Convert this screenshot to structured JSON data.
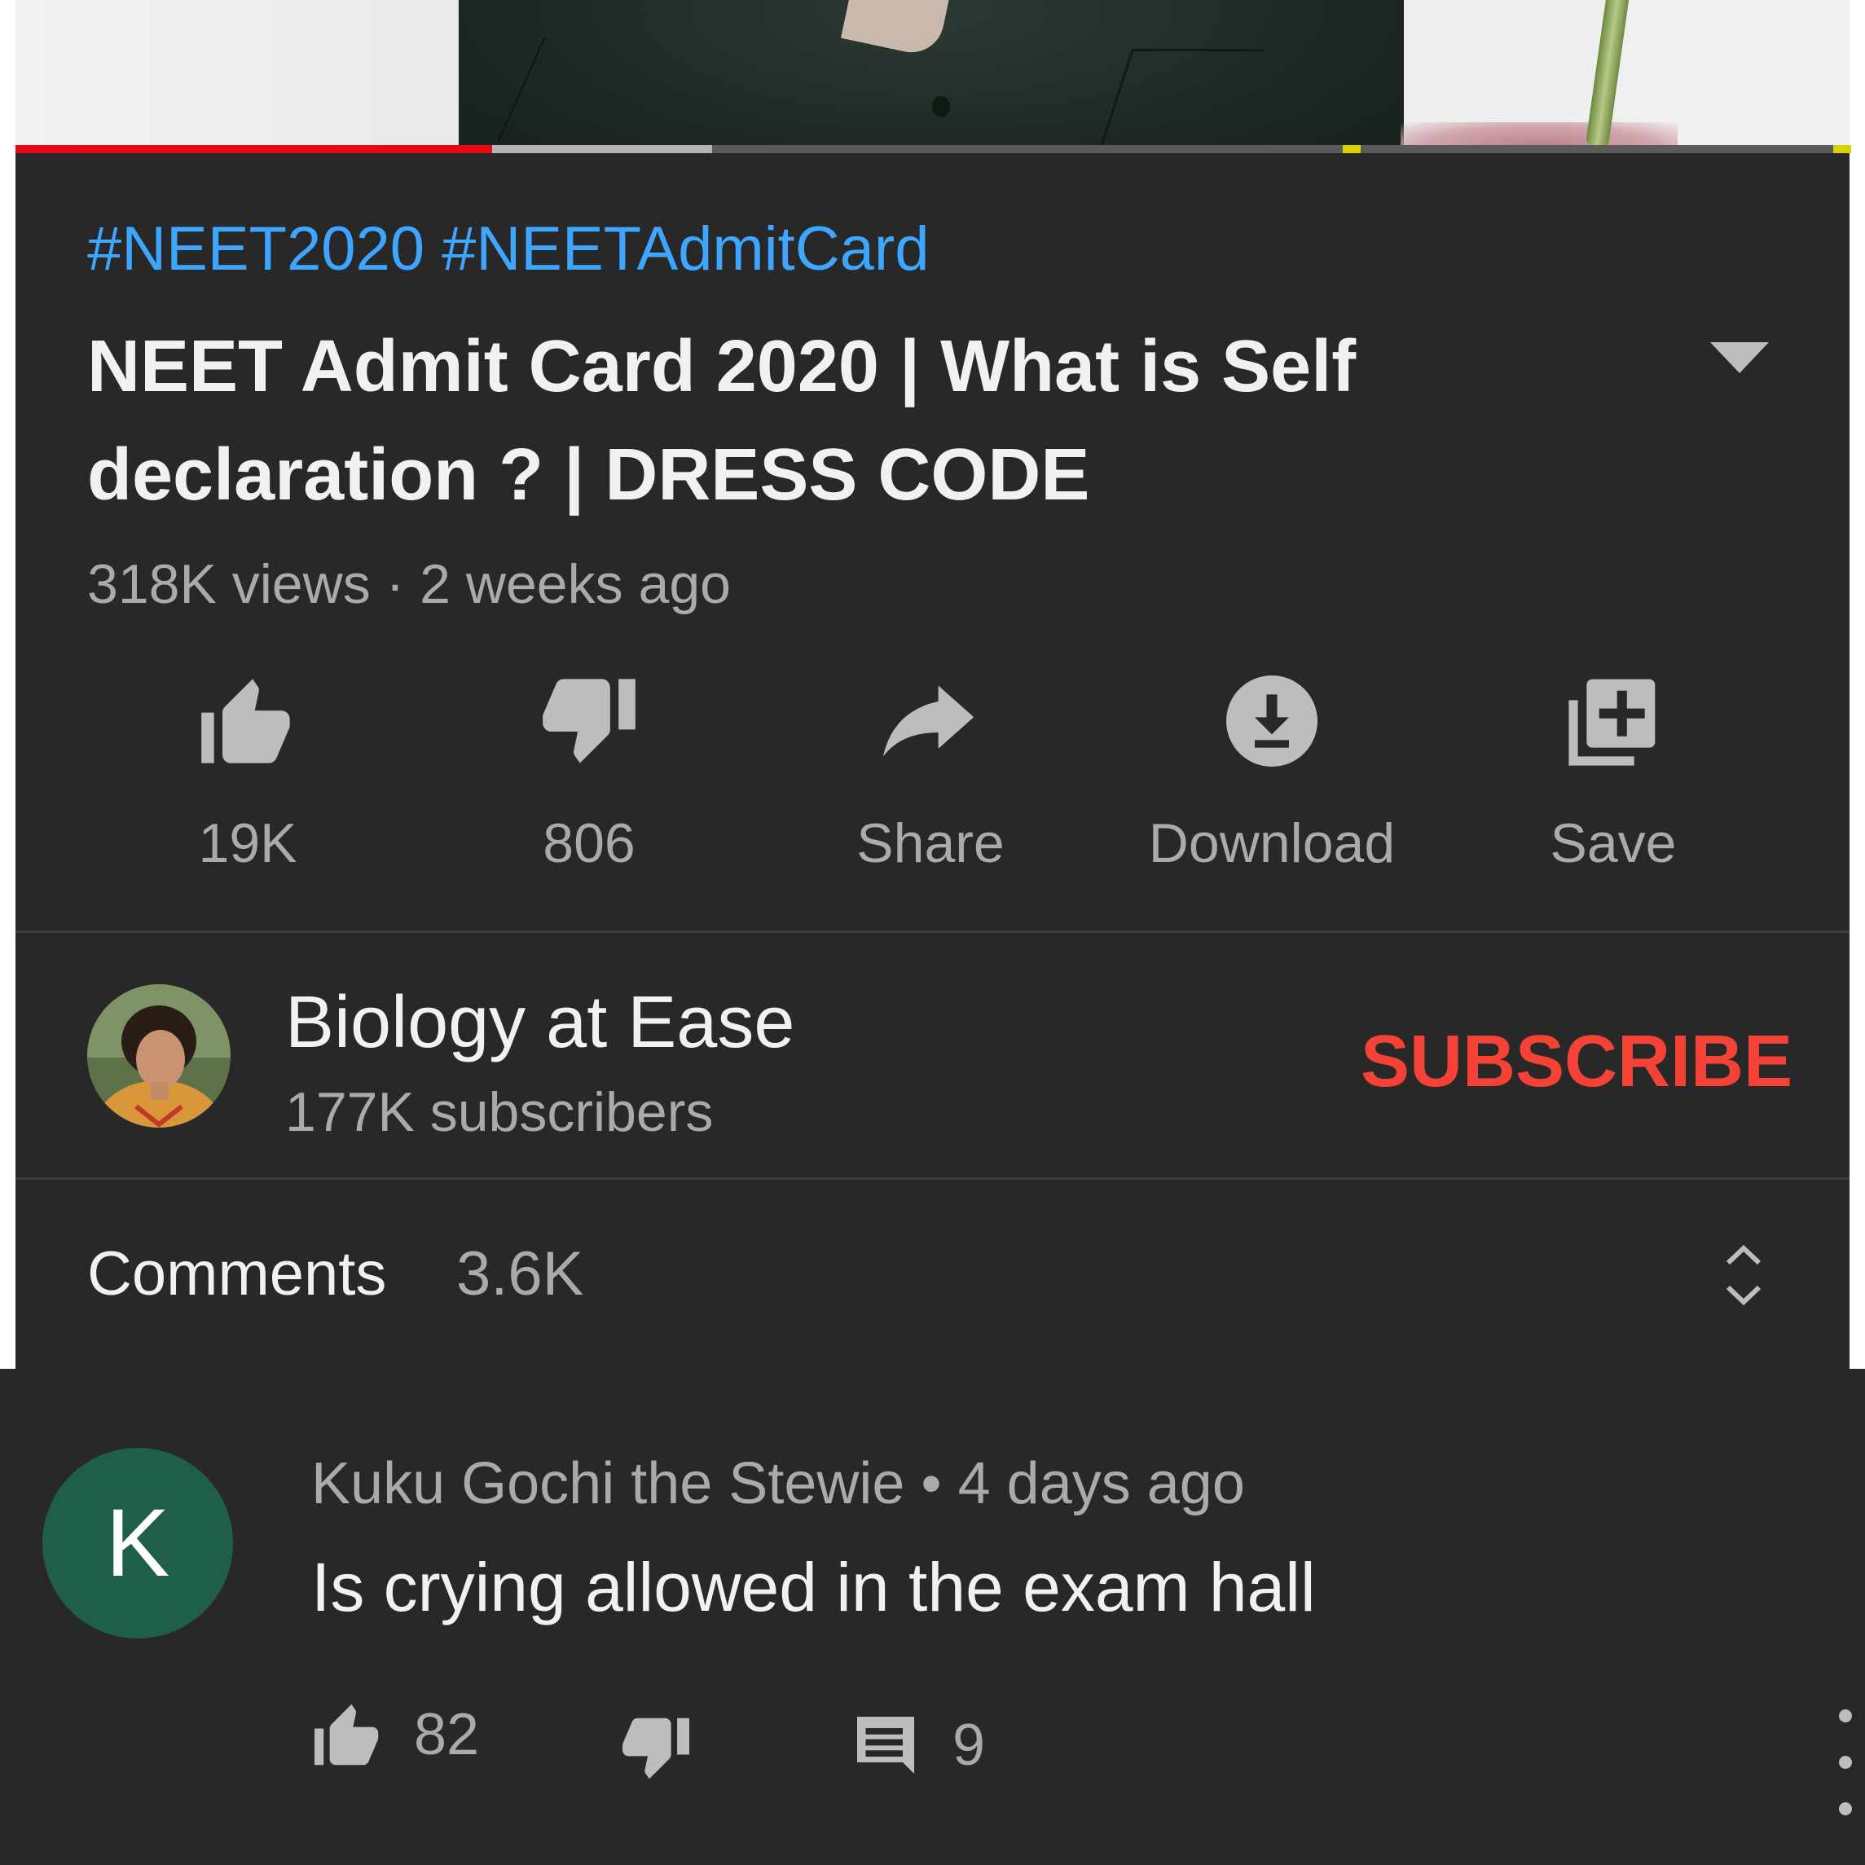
{
  "video": {
    "progress_played": 0.26,
    "progress_buffered": 0.38
  },
  "details": {
    "hashtags": "#NEET2020 #NEETAdmitCard",
    "title": "NEET Admit Card 2020 | What is Self declaration ? | DRESS CODE",
    "meta": "318K views · 2 weeks ago"
  },
  "actions": {
    "like": {
      "label": "19K",
      "icon": "thumb-up-icon"
    },
    "dislike": {
      "label": "806",
      "icon": "thumb-down-icon"
    },
    "share": {
      "label": "Share",
      "icon": "share-icon"
    },
    "download": {
      "label": "Download",
      "icon": "download-icon"
    },
    "save": {
      "label": "Save",
      "icon": "playlist-add-icon"
    }
  },
  "channel": {
    "name": "Biology at Ease",
    "subscribers": "177K subscribers",
    "subscribe_label": "SUBSCRIBE"
  },
  "comments": {
    "label": "Comments",
    "count": "3.6K"
  },
  "comment": {
    "avatar_letter": "K",
    "author_line": "Kuku Gochi the Stewie • 4 days ago",
    "text": "Is crying allowed in the exam hall",
    "likes": "82",
    "replies": "9"
  },
  "colors": {
    "background": "#282828",
    "hashtag": "#3ea6ff",
    "subscribe": "#f44336",
    "progress": "#e50914",
    "comment_avatar": "#1e5e4a"
  }
}
